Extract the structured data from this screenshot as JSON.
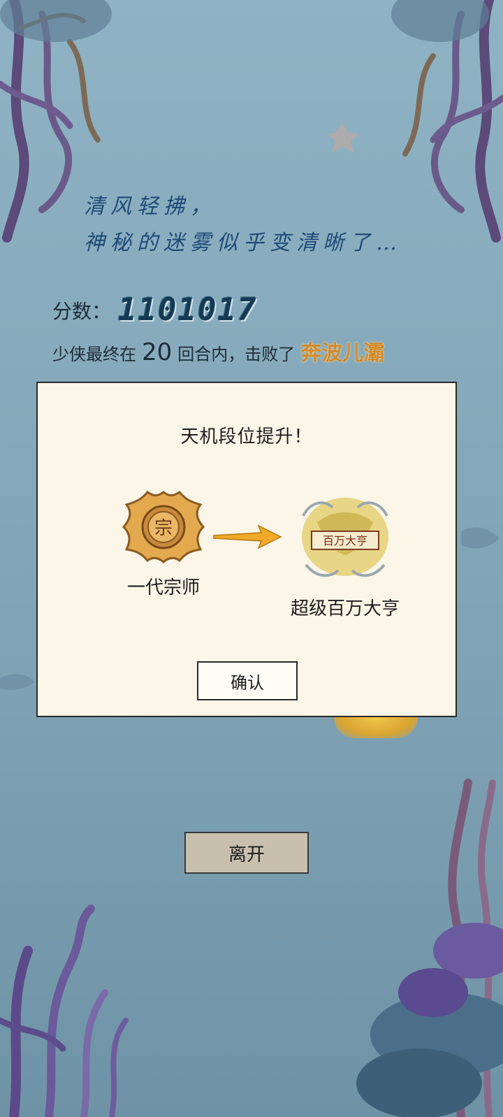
{
  "header": {
    "tagline_line1": "清风轻拂，",
    "tagline_line2": "神秘的迷雾似乎变清晰了…"
  },
  "score": {
    "label": "分数：",
    "value": "1101017"
  },
  "result": {
    "prefix": "少侠最终在",
    "rounds": "20",
    "middle": "回合内，击败了",
    "boss_name": "奔波儿灞"
  },
  "dialog": {
    "title": "天机段位提升！",
    "old_rank": {
      "label": "一代宗师",
      "badge_char": "宗"
    },
    "new_rank": {
      "label": "超级百万大亨",
      "badge_text": "百万大亨"
    },
    "confirm_label": "确认"
  },
  "footer": {
    "leave_label": "离开"
  },
  "colors": {
    "background": "#86aabb",
    "dialog_bg": "#fbf6e8",
    "boss_name": "#d28a2a",
    "tagline": "#1f4a78",
    "button_bg": "#c9bfae"
  }
}
